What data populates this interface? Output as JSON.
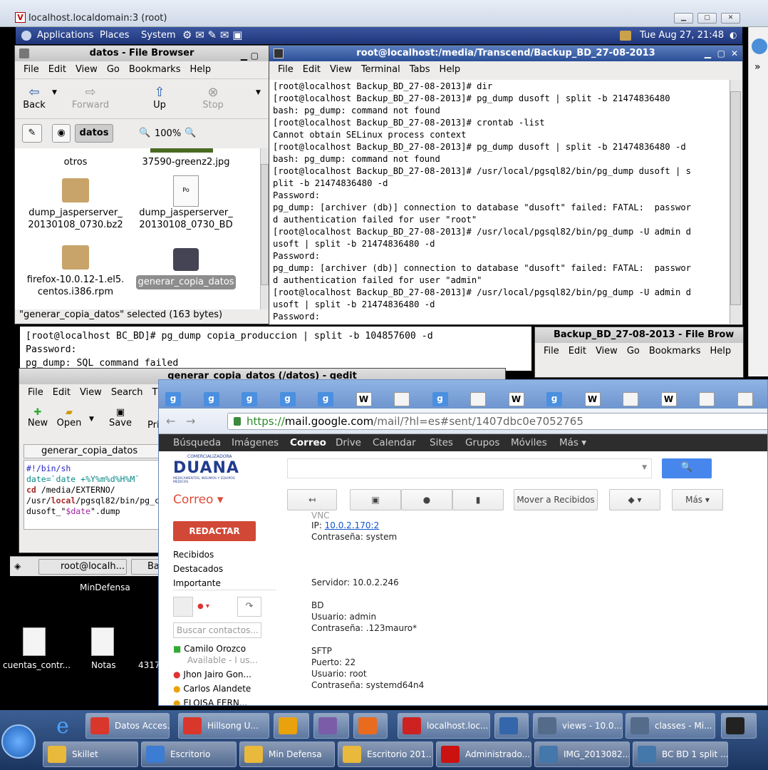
{
  "vnc": {
    "title": "localhost.localdomain:3 (root)",
    "logo": "V"
  },
  "panel": {
    "applications": "Applications",
    "places": "Places",
    "system": "System",
    "clock": "Tue Aug 27, 21:48"
  },
  "file_browser": {
    "title": "datos - File Browser",
    "menu": [
      "File",
      "Edit",
      "View",
      "Go",
      "Bookmarks",
      "Help"
    ],
    "toolbar": {
      "back": "Back",
      "forward": "Forward",
      "up": "Up",
      "stop": "Stop"
    },
    "location": "datos",
    "zoom": "100%",
    "files": [
      {
        "name": "otros"
      },
      {
        "name": "37590-greenz2.jpg"
      },
      {
        "name": "dump_jasperserver_\n20130108_0730.bz2"
      },
      {
        "name": "dump_jasperserver_\n20130108_0730_BD"
      },
      {
        "name": "firefox-10.0.12-1.el5.\ncentos.i386.rpm"
      },
      {
        "name": "generar_copia_datos"
      }
    ],
    "status": "\"generar_copia_datos\" selected (163 bytes)",
    "doc_icon_label": "Po"
  },
  "terminal": {
    "title": "root@localhost:/media/Transcend/Backup_BD_27-08-2013",
    "menu": [
      "File",
      "Edit",
      "View",
      "Terminal",
      "Tabs",
      "Help"
    ],
    "lines": "[root@localhost Backup_BD_27-08-2013]# dir\n[root@localhost Backup_BD_27-08-2013]# pg_dump dusoft | split -b 21474836480\nbash: pg_dump: command not found\n[root@localhost Backup_BD_27-08-2013]# crontab -list\nCannot obtain SELinux process context\n[root@localhost Backup_BD_27-08-2013]# pg_dump dusoft | split -b 21474836480 -d\nbash: pg_dump: command not found\n[root@localhost Backup_BD_27-08-2013]# /usr/local/pgsql82/bin/pg_dump dusoft | s\nplit -b 21474836480 -d\nPassword:\npg_dump: [archiver (db)] connection to database \"dusoft\" failed: FATAL:  passwor\nd authentication failed for user \"root\"\n[root@localhost Backup_BD_27-08-2013]# /usr/local/pgsql82/bin/pg_dump -U admin d\nusoft | split -b 21474836480 -d\nPassword:\npg_dump: [archiver (db)] connection to database \"dusoft\" failed: FATAL:  passwor\nd authentication failed for user \"admin\"\n[root@localhost Backup_BD_27-08-2013]# /usr/local/pgsql82/bin/pg_dump -U admin d\nusoft | split -b 21474836480 -d\nPassword: "
  },
  "bg_terminal": {
    "lines": "[root@localhost BC_BD]# pg_dump copia_produccion | split -b 104857600 -d\nPassword:\npg_dump: SQL command failed"
  },
  "backup_browser": {
    "title": "Backup_BD_27-08-2013 - File Brow",
    "menu": [
      "File",
      "Edit",
      "View",
      "Go",
      "Bookmarks",
      "Help"
    ]
  },
  "gedit": {
    "title": "generar_copia_datos (/datos) - gedit",
    "menu": [
      "File",
      "Edit",
      "View",
      "Search",
      "T"
    ],
    "toolbar": {
      "new": "New",
      "open": "Open",
      "save": "Save",
      "print": "Pri"
    },
    "tab": "generar_copia_datos",
    "code": {
      "l1": "#!/bin/sh",
      "l2": "date=`date +%Y%m%d%H%M`",
      "l3a": "cd",
      "l3b": " /media/EXTERNO/",
      "l4a": "/usr/",
      "l4b": "local",
      "l4c": "/pgsql82/bin/pg_c",
      "l5a": "dusoft_\"",
      "l5b": "$date",
      "l5c": "\".dump"
    }
  },
  "gnome_taskbar": {
    "items": [
      "root@localh...",
      "Ba"
    ]
  },
  "desktop": {
    "minDefensa": "MinDefensa",
    "icons": [
      "cuentas_contr...",
      "Notas",
      "4317"
    ]
  },
  "browser": {
    "url_prefix": "https://",
    "url_host": "mail.google.com",
    "url_path": "/mail/?hl=es#sent/1407dbc0e7052765",
    "tab_glyphs": [
      "g",
      "g",
      "g",
      "g",
      "g",
      "W",
      "",
      "g",
      "",
      "W",
      "g",
      "W",
      "",
      "W",
      "",
      ""
    ],
    "google_bar": [
      "Búsqueda",
      "Imágenes",
      "Correo",
      "Drive",
      "Calendar",
      "Sites",
      "Grupos",
      "Móviles",
      "Más ▾"
    ],
    "logo_main": "DUANA",
    "logo_sub": "COMERCIALIZADORA",
    "logo_tag": "MEDICAMENTOS, INSUMOS Y EQUIPOS MEDICOS",
    "correo": "Correo ▾",
    "compose": "REDACTAR",
    "folders": [
      "Recibidos",
      "Destacados",
      "Importante"
    ],
    "move_btn": "Mover a Recibidos",
    "more_btn": "Más ▾",
    "search_contacts": "Buscar contactos...",
    "contacts": [
      {
        "name": "Camilo Orozco",
        "sub": "Available - I us..."
      },
      {
        "name": "Jhon Jairo Gon..."
      },
      {
        "name": "Carlos Alandete"
      },
      {
        "name": "ELOISA FERN..."
      }
    ],
    "mail": {
      "top": "VNC",
      "ip_label": "IP: ",
      "ip": "10.0.2.170:2",
      "pass1": "Contraseña: system",
      "server": "Servidor: 10.0.2.246",
      "bd": "BD",
      "user1": "Usuario: admin",
      "pass2": "Contraseña: .123mauro*",
      "sftp": "SFTP",
      "port": "Puerto: 22",
      "user2": "Usuario: root",
      "pass3": "Contraseña: systemd64n4"
    }
  },
  "win_taskbar": {
    "row1": [
      "Datos Acces...",
      "Hillsong U...",
      "",
      "",
      "",
      "localhost.loc...",
      "",
      "views - 10.0....",
      "classes - Mi...",
      ""
    ],
    "row2": [
      "Skillet",
      "Escritorio",
      "Min Defensa",
      "Escritorio 201...",
      "Administrado...",
      "IMG_2013082...",
      "BC BD 1 split ..."
    ]
  }
}
